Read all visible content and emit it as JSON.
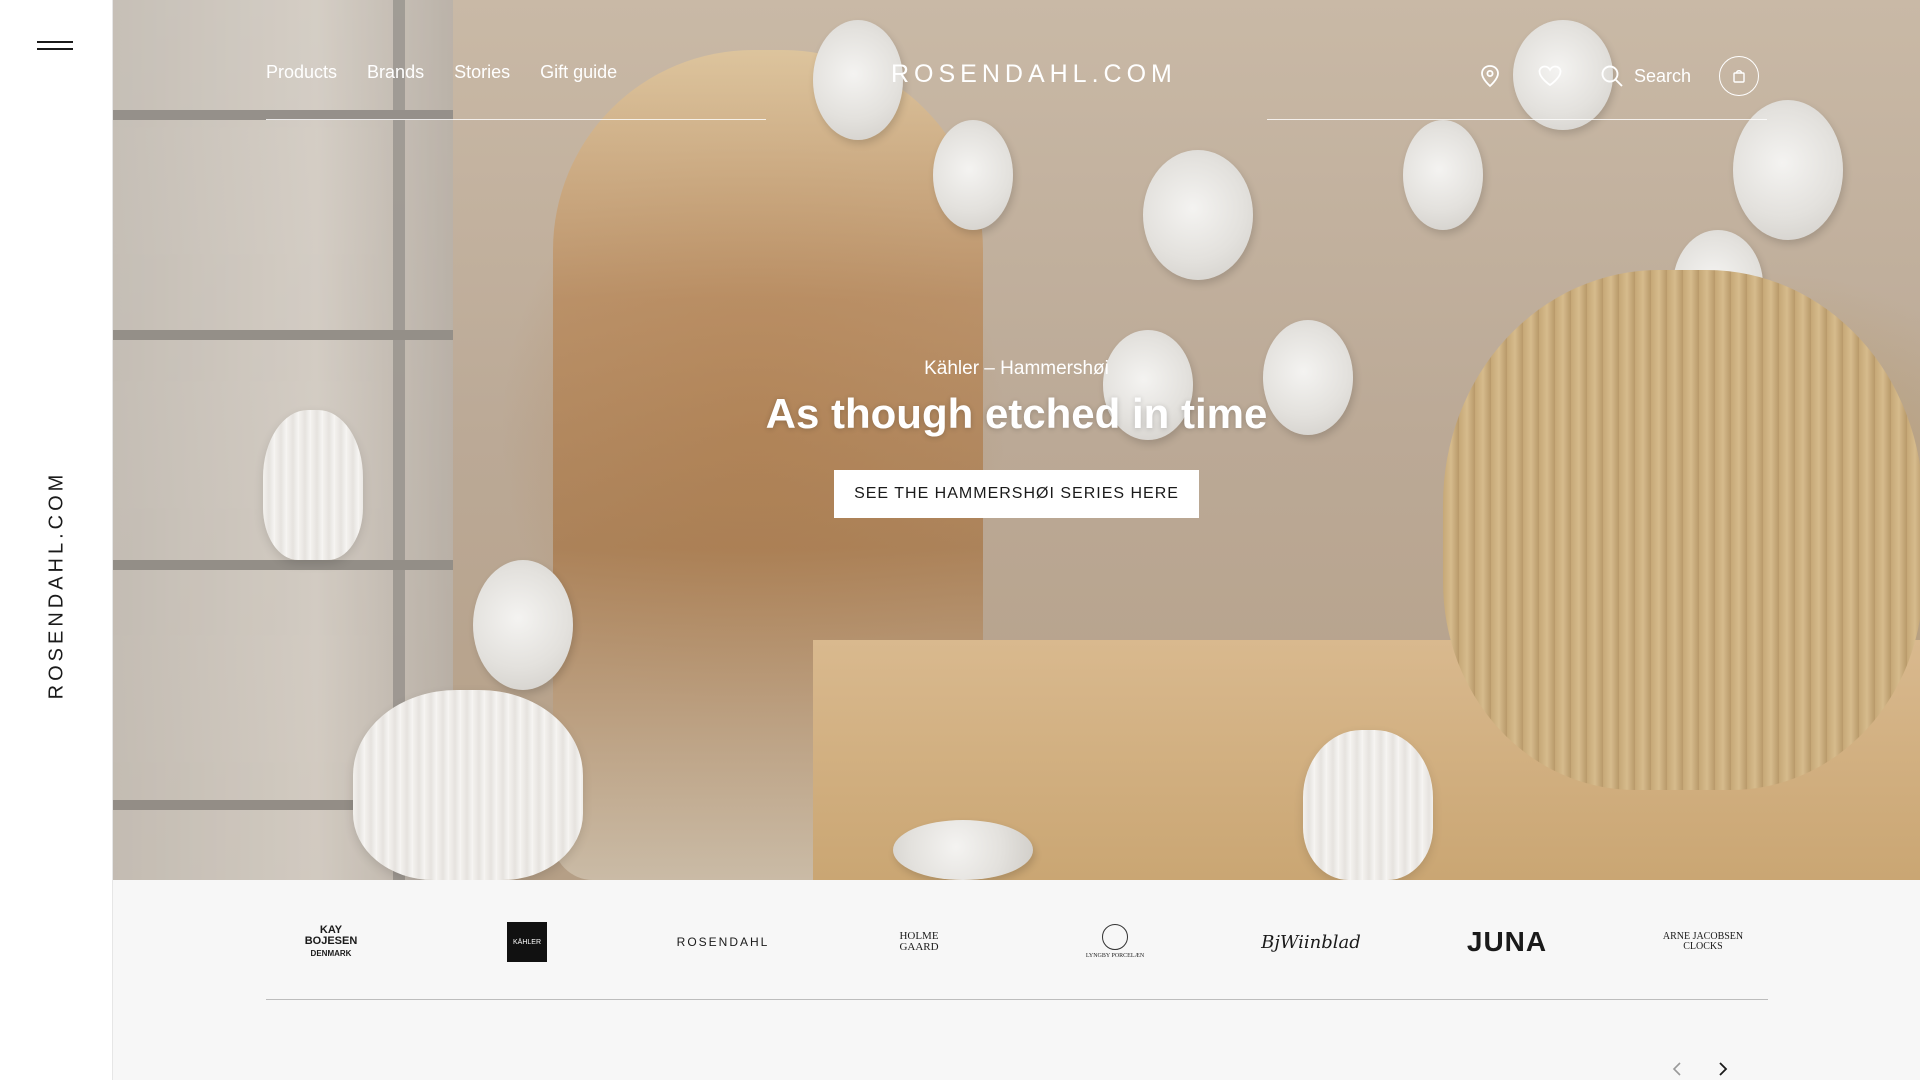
{
  "rail": {
    "brand": "ROSENDAHL.COM"
  },
  "nav": {
    "links": [
      "Products",
      "Brands",
      "Stories",
      "Gift guide"
    ],
    "logo": "ROSENDAHL.COM",
    "search_label": "Search",
    "icons": [
      "location-icon",
      "heart-icon",
      "search-icon",
      "bag-icon"
    ]
  },
  "hero": {
    "eyebrow": "Kähler – Hammershøi",
    "headline": "As though etched in time",
    "cta": "SEE THE HAMMERSHØI SERIES HERE"
  },
  "brands": {
    "items": [
      {
        "name": "KAY BOJESEN DENMARK",
        "line1": "KAY",
        "line2": "BOJESEN",
        "line3": "DENMARK"
      },
      {
        "name": "KÄHLER",
        "text": "KÄHLER"
      },
      {
        "name": "ROSENDAHL",
        "text": "ROSENDAHL"
      },
      {
        "name": "HOLME GAARD",
        "line1": "HOLME",
        "line2": "GAARD"
      },
      {
        "name": "LYNGBY PORCELÆN",
        "text": "LYNGBY PORCELÆN"
      },
      {
        "name": "Bjørn Wiinblad",
        "text": "BjWiinblad"
      },
      {
        "name": "JUNA",
        "text": "JUNA"
      },
      {
        "name": "ARNE JACOBSEN CLOCKS",
        "line1": "ARNE JACOBSEN",
        "line2": "CLOCKS"
      }
    ]
  },
  "colors": {
    "accent": "#ffffff",
    "text": "#1a1a1a",
    "strip_bg": "#f7f7f7"
  }
}
